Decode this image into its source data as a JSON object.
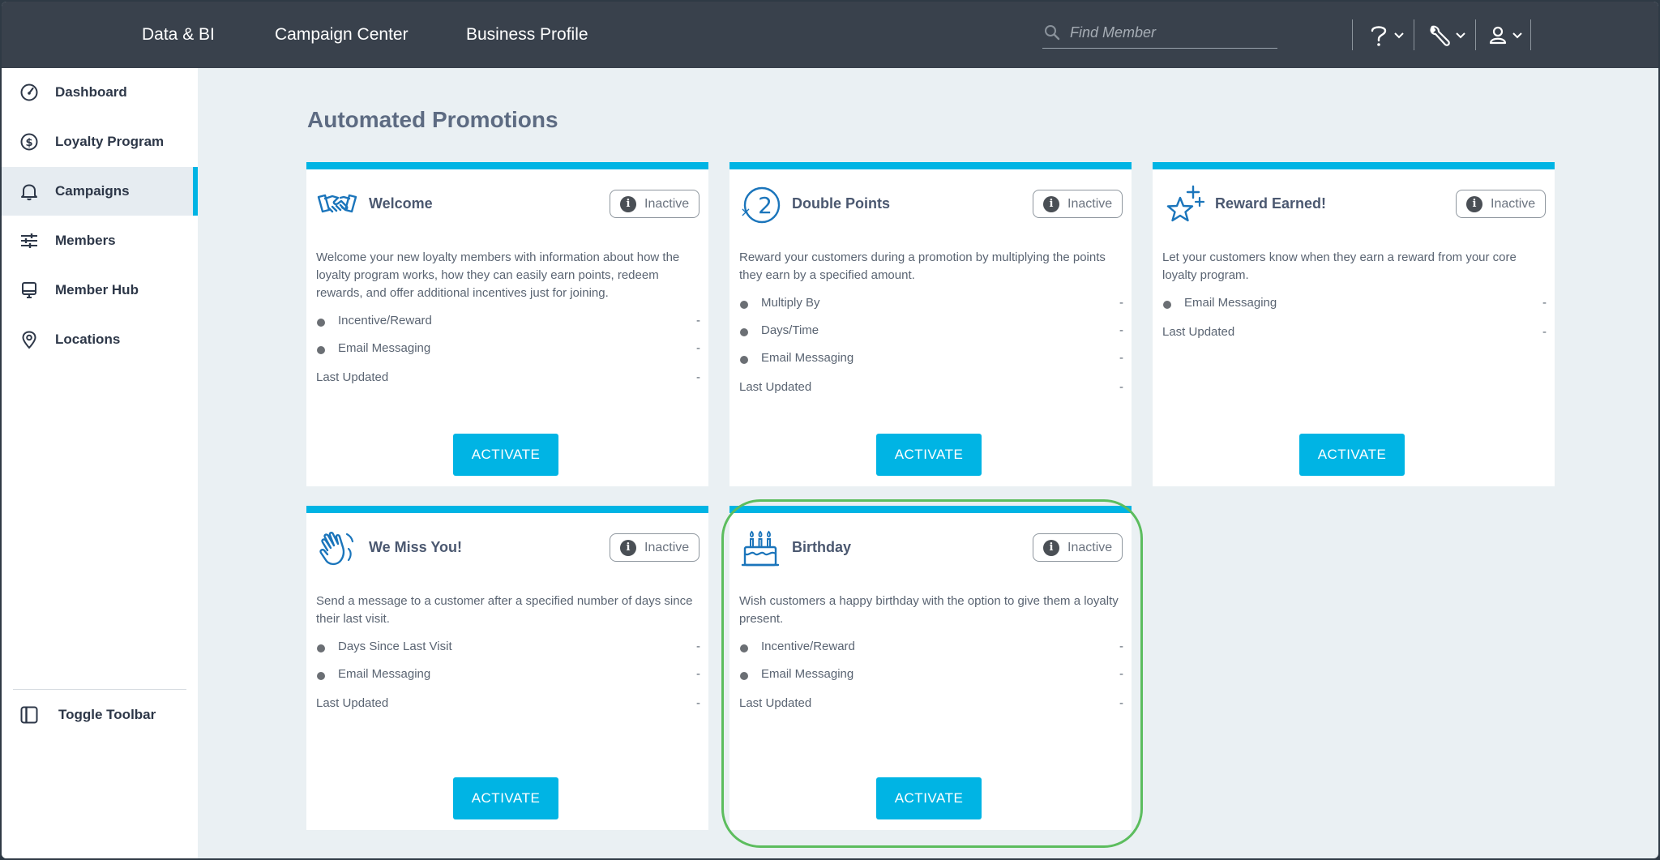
{
  "topnav": {
    "items": [
      "Data & BI",
      "Campaign Center",
      "Business Profile"
    ]
  },
  "search": {
    "placeholder": "Find Member"
  },
  "toolbar_icons": [
    "question-icon",
    "wrench-icon",
    "user-icon"
  ],
  "sidebar": {
    "items": [
      {
        "label": "Dashboard",
        "icon": "gauge-icon"
      },
      {
        "label": "Loyalty Program",
        "icon": "dollar-circle-icon"
      },
      {
        "label": "Campaigns",
        "icon": "bell-icon",
        "active": true
      },
      {
        "label": "Members",
        "icon": "sliders-icon"
      },
      {
        "label": "Member Hub",
        "icon": "monitor-icon"
      },
      {
        "label": "Locations",
        "icon": "map-pin-icon"
      }
    ],
    "toggle_label": "Toggle Toolbar"
  },
  "page": {
    "title": "Automated Promotions"
  },
  "cards": [
    {
      "title": "Welcome",
      "icon": "handshake-icon",
      "status": "Inactive",
      "description": "Welcome your new loyalty members with information about how the loyalty program works, how they can easily earn points, redeem rewards, and offer additional incentives just for joining.",
      "rows": [
        {
          "label": "Incentive/Reward",
          "value": "-"
        },
        {
          "label": "Email Messaging",
          "value": "-"
        }
      ],
      "last_updated_label": "Last Updated",
      "last_updated_value": "-",
      "button": "ACTIVATE"
    },
    {
      "title": "Double Points",
      "icon": "times-two-icon",
      "icon_text": "2",
      "icon_small": "×",
      "status": "Inactive",
      "description": "Reward your customers during a promotion by multiplying the points they earn by a specified amount.",
      "rows": [
        {
          "label": "Multiply By",
          "value": "-"
        },
        {
          "label": "Days/Time",
          "value": "-"
        },
        {
          "label": "Email Messaging",
          "value": "-"
        }
      ],
      "last_updated_label": "Last Updated",
      "last_updated_value": "-",
      "button": "ACTIVATE"
    },
    {
      "title": "Reward Earned!",
      "icon": "star-sparkle-icon",
      "status": "Inactive",
      "description": "Let your customers know when they earn a reward from your core loyalty program.",
      "rows": [
        {
          "label": "Email Messaging",
          "value": "-"
        }
      ],
      "last_updated_label": "Last Updated",
      "last_updated_value": "-",
      "button": "ACTIVATE"
    },
    {
      "title": "We Miss You!",
      "icon": "waving-hand-icon",
      "status": "Inactive",
      "description": "Send a message to a customer after a specified number of days since their last visit.",
      "rows": [
        {
          "label": "Days Since Last Visit",
          "value": "-"
        },
        {
          "label": "Email Messaging",
          "value": "-"
        }
      ],
      "last_updated_label": "Last Updated",
      "last_updated_value": "-",
      "button": "ACTIVATE"
    },
    {
      "title": "Birthday",
      "icon": "birthday-cake-icon",
      "status": "Inactive",
      "description": "Wish customers a happy birthday with the option to give them a loyalty present.",
      "rows": [
        {
          "label": "Incentive/Reward",
          "value": "-"
        },
        {
          "label": "Email Messaging",
          "value": "-"
        }
      ],
      "last_updated_label": "Last Updated",
      "last_updated_value": "-",
      "button": "ACTIVATE"
    }
  ],
  "colors": {
    "topbar": "#39414c",
    "accent": "#00b4e4",
    "highlight": "#5cbd5e",
    "page_bg": "#eaf0f3"
  }
}
